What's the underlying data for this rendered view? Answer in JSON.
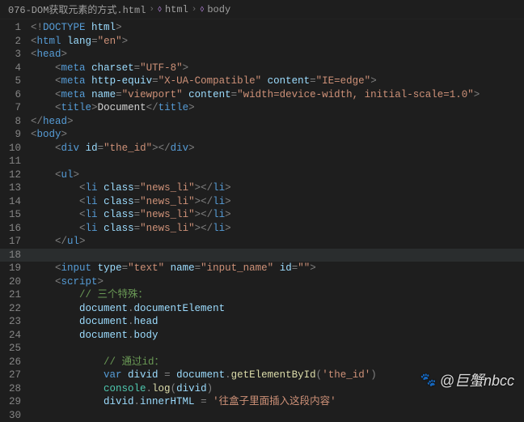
{
  "breadcrumbs": {
    "file": "076-DOM获取元素的方式.html",
    "path1": "html",
    "path2": "body"
  },
  "watermark": "@巨蟹nbcc",
  "lines": [
    {
      "n": 1,
      "indent": 0,
      "type": "tag",
      "raw": "<!DOCTYPE html>",
      "parts": [
        [
          "pun",
          "<!"
        ],
        [
          "tag",
          "DOCTYPE"
        ],
        [
          "txt",
          " "
        ],
        [
          "attr",
          "html"
        ],
        [
          "pun",
          ">"
        ]
      ]
    },
    {
      "n": 2,
      "indent": 0,
      "type": "tag-open",
      "name": "html",
      "attrs": [
        [
          "lang",
          "en"
        ]
      ]
    },
    {
      "n": 3,
      "indent": 0,
      "type": "tag-open",
      "name": "head"
    },
    {
      "n": 4,
      "indent": 1,
      "type": "tag-self",
      "name": "meta",
      "attrs": [
        [
          "charset",
          "UTF-8"
        ]
      ]
    },
    {
      "n": 5,
      "indent": 1,
      "type": "tag-self",
      "name": "meta",
      "attrs": [
        [
          "http-equiv",
          "X-UA-Compatible"
        ],
        [
          "content",
          "IE=edge"
        ]
      ]
    },
    {
      "n": 6,
      "indent": 1,
      "type": "tag-self",
      "name": "meta",
      "attrs": [
        [
          "name",
          "viewport"
        ],
        [
          "content",
          "width=device-width, initial-scale=1.0"
        ]
      ]
    },
    {
      "n": 7,
      "indent": 1,
      "type": "tag-pair",
      "name": "title",
      "inner": "Document"
    },
    {
      "n": 8,
      "indent": 0,
      "type": "tag-close",
      "name": "head"
    },
    {
      "n": 9,
      "indent": 0,
      "type": "tag-open",
      "name": "body"
    },
    {
      "n": 10,
      "indent": 1,
      "type": "tag-pair",
      "name": "div",
      "attrs": [
        [
          "id",
          "the_id"
        ]
      ],
      "inner": ""
    },
    {
      "n": 11,
      "indent": 0,
      "type": "blank"
    },
    {
      "n": 12,
      "indent": 1,
      "type": "tag-open",
      "name": "ul"
    },
    {
      "n": 13,
      "indent": 2,
      "type": "tag-pair",
      "name": "li",
      "attrs": [
        [
          "class",
          "news_li"
        ]
      ],
      "inner": ""
    },
    {
      "n": 14,
      "indent": 2,
      "type": "tag-pair",
      "name": "li",
      "attrs": [
        [
          "class",
          "news_li"
        ]
      ],
      "inner": ""
    },
    {
      "n": 15,
      "indent": 2,
      "type": "tag-pair",
      "name": "li",
      "attrs": [
        [
          "class",
          "news_li"
        ]
      ],
      "inner": ""
    },
    {
      "n": 16,
      "indent": 2,
      "type": "tag-pair",
      "name": "li",
      "attrs": [
        [
          "class",
          "news_li"
        ]
      ],
      "inner": ""
    },
    {
      "n": 17,
      "indent": 1,
      "type": "tag-close",
      "name": "ul"
    },
    {
      "n": 18,
      "indent": 0,
      "type": "blank",
      "highlight": true
    },
    {
      "n": 19,
      "indent": 1,
      "type": "tag-self",
      "name": "input",
      "attrs": [
        [
          "type",
          "text"
        ],
        [
          "name",
          "input_name"
        ],
        [
          "id",
          ""
        ]
      ]
    },
    {
      "n": 20,
      "indent": 1,
      "type": "tag-open",
      "name": "script"
    },
    {
      "n": 21,
      "indent": 2,
      "type": "js-comment",
      "text": "// 三个特殊："
    },
    {
      "n": 22,
      "indent": 2,
      "type": "js",
      "parts": [
        [
          "var",
          "document"
        ],
        [
          "pun",
          "."
        ],
        [
          "mem",
          "documentElement"
        ]
      ]
    },
    {
      "n": 23,
      "indent": 2,
      "type": "js",
      "parts": [
        [
          "var",
          "document"
        ],
        [
          "pun",
          "."
        ],
        [
          "mem",
          "head"
        ]
      ]
    },
    {
      "n": 24,
      "indent": 2,
      "type": "js",
      "parts": [
        [
          "var",
          "document"
        ],
        [
          "pun",
          "."
        ],
        [
          "mem",
          "body"
        ]
      ]
    },
    {
      "n": 25,
      "indent": 0,
      "type": "blank"
    },
    {
      "n": 26,
      "indent": 3,
      "type": "js-comment",
      "text": "// 通过id："
    },
    {
      "n": 27,
      "indent": 3,
      "type": "js",
      "parts": [
        [
          "kw",
          "var"
        ],
        [
          "txt",
          " "
        ],
        [
          "var",
          "divid"
        ],
        [
          "txt",
          " "
        ],
        [
          "pun",
          "="
        ],
        [
          "txt",
          " "
        ],
        [
          "var",
          "document"
        ],
        [
          "pun",
          "."
        ],
        [
          "fn",
          "getElementById"
        ],
        [
          "pun",
          "("
        ],
        [
          "str",
          "'the_id'"
        ],
        [
          "pun",
          ")"
        ]
      ]
    },
    {
      "n": 28,
      "indent": 3,
      "type": "js",
      "parts": [
        [
          "cls",
          "console"
        ],
        [
          "pun",
          "."
        ],
        [
          "fn",
          "log"
        ],
        [
          "pun",
          "("
        ],
        [
          "var",
          "divid"
        ],
        [
          "pun",
          ")"
        ]
      ]
    },
    {
      "n": 29,
      "indent": 3,
      "type": "js",
      "parts": [
        [
          "var",
          "divid"
        ],
        [
          "pun",
          "."
        ],
        [
          "mem",
          "innerHTML"
        ],
        [
          "txt",
          " "
        ],
        [
          "pun",
          "="
        ],
        [
          "txt",
          " "
        ],
        [
          "str",
          "'往盒子里面插入这段内容'"
        ]
      ]
    },
    {
      "n": 30,
      "indent": 0,
      "type": "blank"
    }
  ]
}
